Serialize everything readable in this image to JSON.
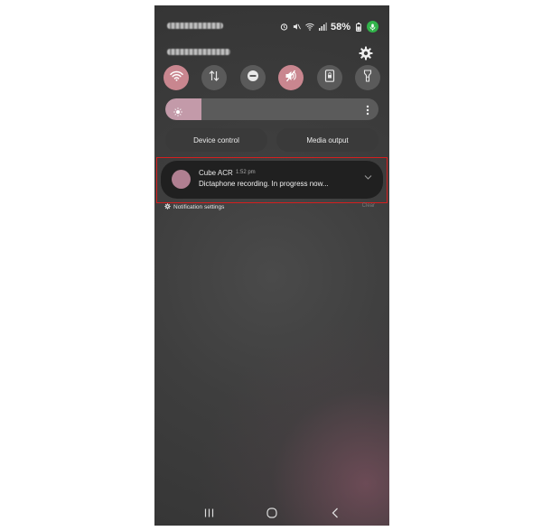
{
  "status_bar": {
    "battery": "58%"
  },
  "quick_settings": {
    "tiles": [
      {
        "icon": "wifi-icon",
        "state": "on"
      },
      {
        "icon": "mobile-data-icon",
        "state": "off"
      },
      {
        "icon": "do-not-disturb-icon",
        "state": "off"
      },
      {
        "icon": "mute-icon",
        "state": "on"
      },
      {
        "icon": "portrait-lock-icon",
        "state": "off"
      },
      {
        "icon": "flashlight-icon",
        "state": "off"
      }
    ],
    "brightness_level": 0.17,
    "device_control_label": "Device control",
    "media_output_label": "Media output"
  },
  "notification": {
    "app_name": "Cube ACR",
    "time": "1:52 pm",
    "body": "Dictaphone recording. In progress now...",
    "avatar_color": "#b07f91"
  },
  "footer": {
    "settings_label": "Notification settings",
    "clear_label": "Clear"
  },
  "colors": {
    "accent": "#c9868f",
    "highlight": "#d51f1f",
    "mic": "#31b34a"
  }
}
